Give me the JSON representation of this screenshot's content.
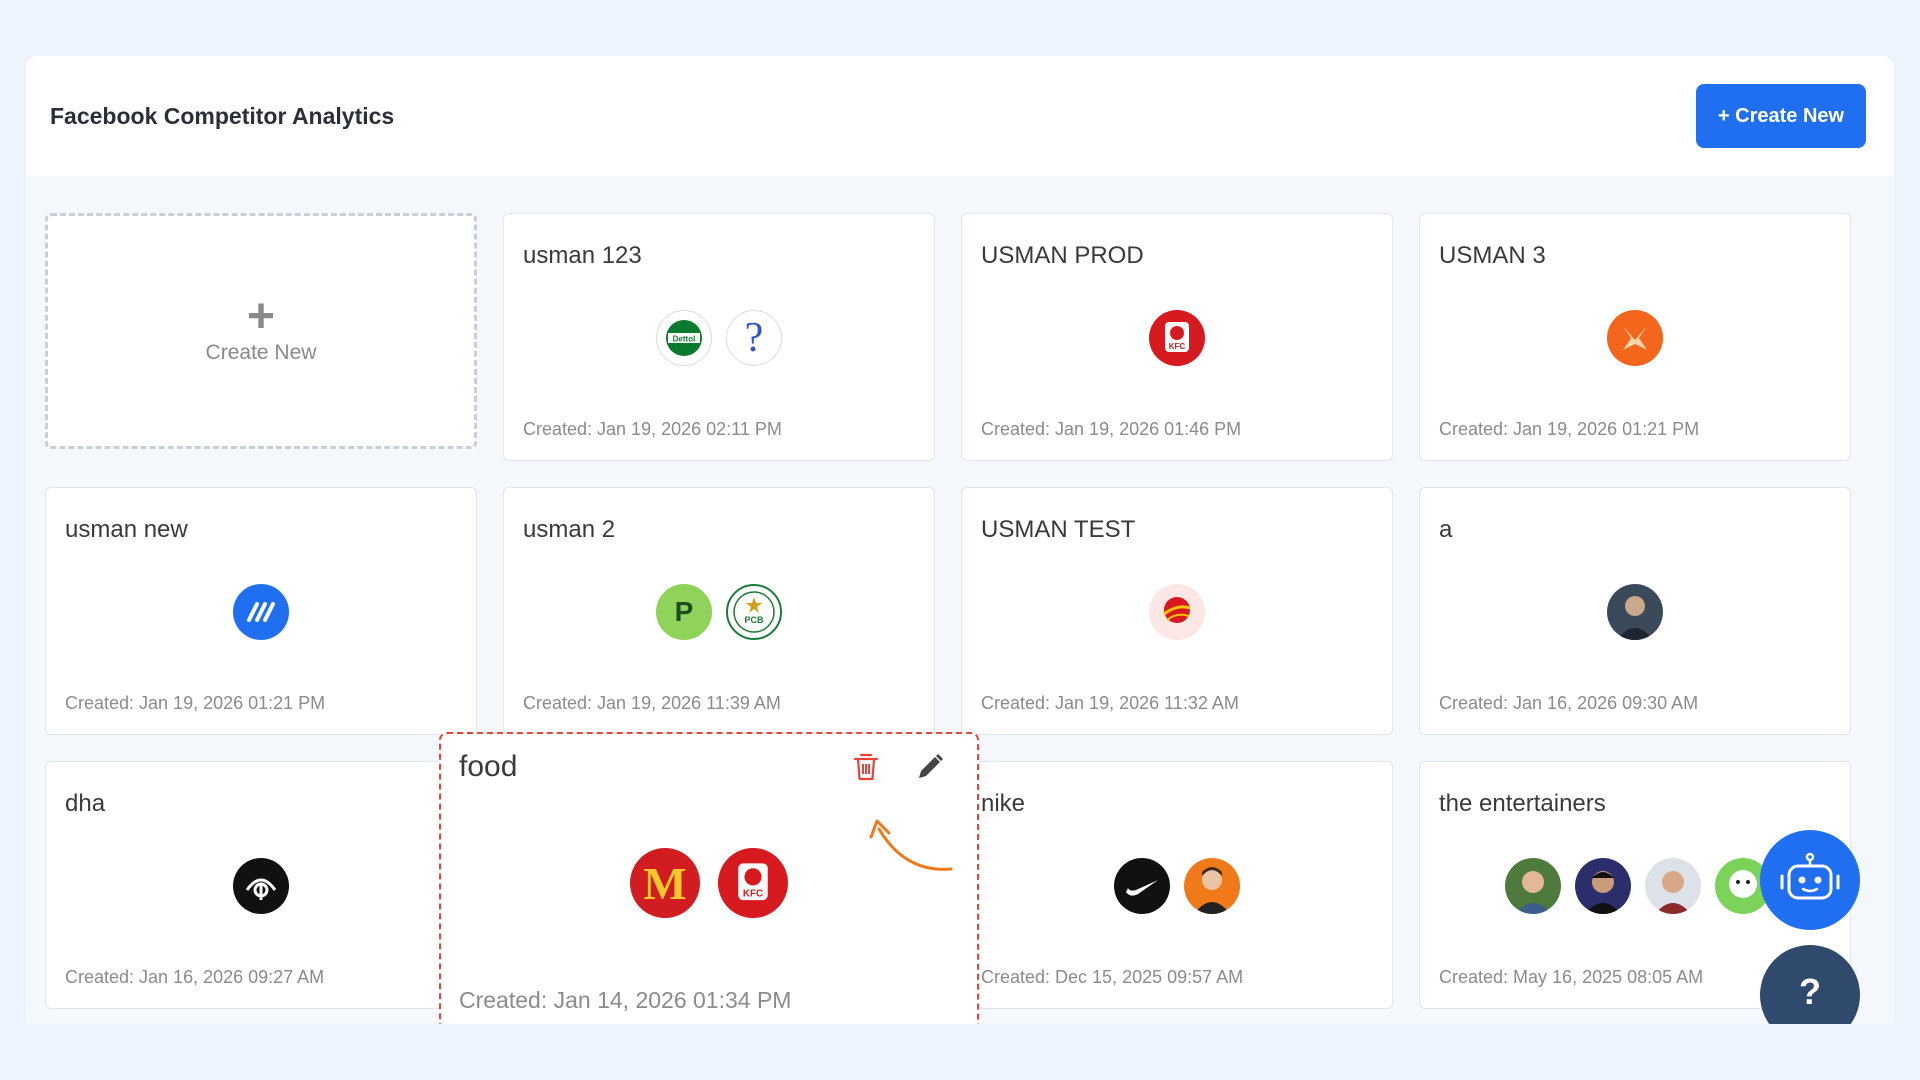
{
  "header": {
    "title": "Facebook Competitor Analytics",
    "create_label": "+ Create New"
  },
  "new_card": {
    "plus": "+",
    "label": "Create New"
  },
  "cards": [
    {
      "title": "usman 123",
      "created": "Created: Jan 19, 2026 02:11 PM",
      "logos": [
        "dettol-logo",
        "question-logo"
      ]
    },
    {
      "title": "USMAN PROD",
      "created": "Created: Jan 19, 2026 01:46 PM",
      "logos": [
        "kfc-logo"
      ]
    },
    {
      "title": "USMAN 3",
      "created": "Created: Jan 19, 2026 01:21 PM",
      "logos": [
        "orange-x-logo"
      ]
    },
    {
      "title": "usman new",
      "created": "Created: Jan 19, 2026 01:21 PM",
      "logos": [
        "blue-stripes-logo"
      ]
    },
    {
      "title": "usman 2",
      "created": "Created: Jan 19, 2026 11:39 AM",
      "logos": [
        "p-logo",
        "pcb-logo"
      ]
    },
    {
      "title": "USMAN TEST",
      "created": "Created: Jan 19, 2026 11:32 AM",
      "logos": [
        "red-globe-logo"
      ]
    },
    {
      "title": "a",
      "created": "Created: Jan 16, 2026 09:30 AM",
      "logos": [
        "profile-avatar"
      ]
    },
    {
      "title": "dha",
      "created": "Created: Jan 16, 2026 09:27 AM",
      "logos": [
        "dha-logo"
      ]
    },
    {
      "title": "nike",
      "created": "Created: Dec 15, 2025 09:57 AM",
      "logos": [
        "nike-logo",
        "person-avatar"
      ]
    },
    {
      "title": "the entertainers",
      "created": "Created: May 16, 2025 08:05 AM",
      "logos": [
        "avatar-1",
        "avatar-2",
        "avatar-3",
        "avatar-4"
      ]
    }
  ],
  "food_card": {
    "title": "food",
    "created": "Created: Jan 14, 2026 01:34 PM",
    "logos": [
      "mcdonalds-logo",
      "kfc-logo"
    ]
  },
  "logo_text": {
    "dettol": "Dettol",
    "question": "?",
    "kfc": "KFC",
    "p": "P",
    "pcb": "PCB",
    "mcd": "M"
  },
  "help": {
    "label": "?"
  },
  "colors": {
    "accent": "#1f6ff0",
    "highlight_border": "#e8433a",
    "arrow": "#f07a1a",
    "help_bg": "#2f4a6d"
  }
}
